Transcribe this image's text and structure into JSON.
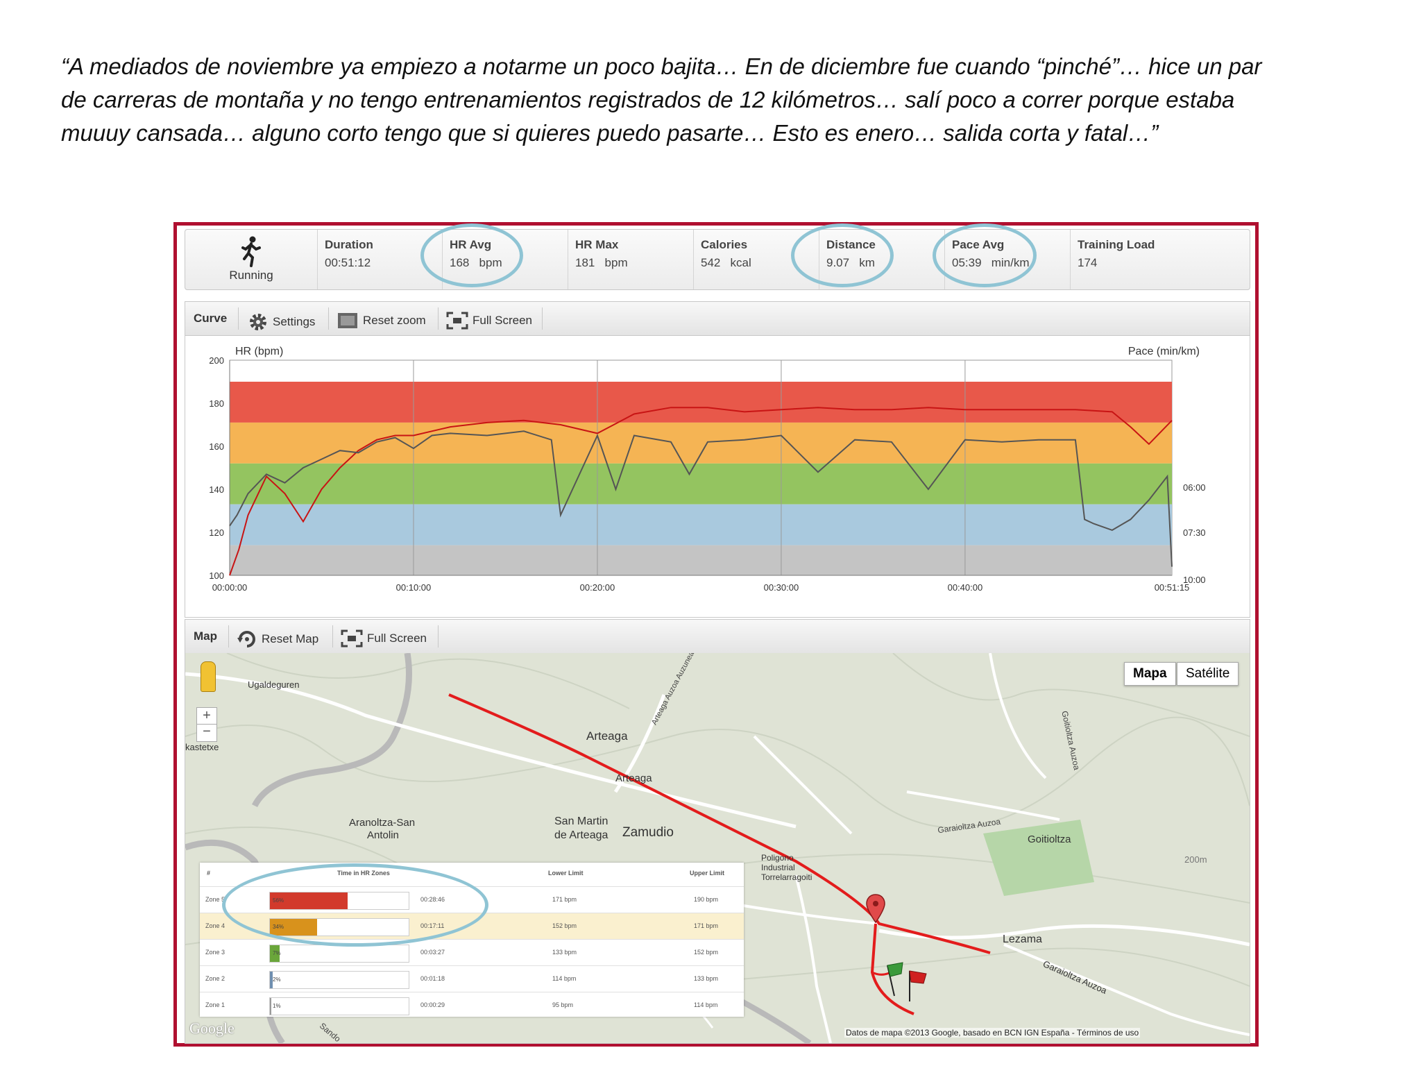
{
  "quote": {
    "line1": "“A mediados de noviembre ya empiezo a notarme un poco bajita… En de diciembre fue cuando “pinché”… hice un par",
    "line2": "de carreras de montaña y no tengo entrenamientos registrados de 12 kilómetros… salí poco a correr porque estaba",
    "line3": "muuuy cansada… alguno corto tengo que si quieres puedo pasarte… Esto es enero… salida corta y fatal…”"
  },
  "summary": {
    "activity": "Running",
    "activity_icon": "runner-icon",
    "stats": [
      {
        "label": "Duration",
        "value": "00:51:12"
      },
      {
        "label": "HR Avg",
        "value": "168   bpm"
      },
      {
        "label": "HR Max",
        "value": "181   bpm"
      },
      {
        "label": "Calories",
        "value": "542   kcal"
      },
      {
        "label": "Distance",
        "value": "9.07   km"
      },
      {
        "label": "Pace Avg",
        "value": "05:39   min/km"
      },
      {
        "label": "Training Load",
        "value": "174"
      }
    ]
  },
  "curve_toolbar": {
    "title": "Curve",
    "settings": "Settings",
    "reset_zoom": "Reset zoom",
    "full_screen": "Full Screen"
  },
  "chart_data": {
    "type": "line",
    "ylabel_left": "HR (bpm)",
    "ylabel_right": "Pace (min/km)",
    "ylim": [
      100,
      200
    ],
    "yticks": [
      "200",
      "180",
      "160",
      "140",
      "120",
      "100"
    ],
    "right_ticks": [
      "06:00",
      "07:30",
      "10:00"
    ],
    "xticks": [
      "00:00:00",
      "00:10:00",
      "00:20:00",
      "00:30:00",
      "00:40:00",
      "00:51:15"
    ],
    "zones": [
      {
        "from": 171,
        "to": 190,
        "color": "#e8584a"
      },
      {
        "from": 152,
        "to": 171,
        "color": "#f5b454"
      },
      {
        "from": 133,
        "to": 152,
        "color": "#94c460"
      },
      {
        "from": 114,
        "to": 133,
        "color": "#a9c9de"
      },
      {
        "from": 100,
        "to": 114,
        "color": "#c4c4c4"
      }
    ],
    "series": [
      {
        "color": "#c81414",
        "x": [
          0,
          0.5,
          1,
          2,
          3,
          4,
          5,
          6,
          7,
          8,
          9,
          10,
          12,
          14,
          16,
          18,
          20,
          22,
          24,
          26,
          28,
          30,
          32,
          34,
          36,
          38,
          40,
          42,
          44,
          46,
          48,
          49,
          50,
          51.25
        ],
        "y": [
          100,
          112,
          128,
          146,
          138,
          125,
          140,
          150,
          158,
          163,
          165,
          165,
          169,
          171,
          172,
          170,
          166,
          175,
          178,
          178,
          176,
          177,
          178,
          177,
          177,
          178,
          177,
          177,
          177,
          177,
          176,
          169,
          161,
          172
        ]
      },
      {
        "color": "#555555",
        "x": [
          0,
          0.4,
          1,
          2,
          3,
          4,
          5,
          6,
          7,
          8,
          9,
          10,
          11,
          12,
          14,
          16,
          17.5,
          18,
          20,
          21,
          22,
          24,
          25,
          26,
          28,
          30,
          32,
          34,
          36,
          38,
          40,
          42,
          44,
          46,
          46.5,
          47,
          48,
          49,
          50,
          51,
          51.25
        ],
        "y": [
          123,
          128,
          138,
          147,
          143,
          150,
          154,
          158,
          157,
          162,
          164,
          159,
          165,
          166,
          165,
          167,
          163,
          128,
          165,
          140,
          165,
          162,
          147,
          162,
          163,
          165,
          148,
          163,
          162,
          140,
          163,
          162,
          163,
          163,
          126,
          124,
          121,
          126,
          135,
          146,
          104
        ]
      }
    ]
  },
  "map_toolbar": {
    "title": "Map",
    "reset_map": "Reset Map",
    "full_screen": "Full Screen"
  },
  "map": {
    "type_buttons": [
      "Mapa",
      "Satélite"
    ],
    "labels": {
      "ugaldeguren": "Ugaldeguren",
      "kastetxe": "kastetxe",
      "arteaga1": "Arteaga",
      "arteaga2": "Arteaga",
      "arteaga_auzoa": "Arteaga Auzoa Auzunea",
      "goitioltza_auzoa": "Goitioltza Auzoa",
      "garaioltza_auzoa": "Garaioltza Auzoa",
      "goitioltza": "Goitioltza",
      "aranoltza1": "Aranoltza-San",
      "aranoltza2": "Antolin",
      "san_martin1": "San Martin",
      "san_martin2": "de Arteaga",
      "zamudio": "Zamudio",
      "poligono1": "Poligono",
      "poligono2": "Industrial",
      "poligono3": "Torrelarragoiti",
      "lezama": "Lezama",
      "garaioltza2": "Garaioltza Auzoa",
      "contour": "200m",
      "sando": "Sando",
      "google": "Google",
      "attribution": "Datos de mapa ©2013 Google, basado en BCN IGN España - Términos de uso"
    }
  },
  "zones_table": {
    "headers": [
      "#",
      "Time in HR Zones",
      "Lower Limit",
      "Upper Limit"
    ],
    "rows": [
      {
        "zone": "Zone 5",
        "pct_label": "56%",
        "fraction": 0.56,
        "time": "00:28:46",
        "lower": "171 bpm",
        "upper": "190 bpm",
        "color": "#d23a2c"
      },
      {
        "zone": "Zone 4",
        "pct_label": "34%",
        "fraction": 0.34,
        "time": "00:17:11",
        "lower": "152 bpm",
        "upper": "171 bpm",
        "color": "#d8921c"
      },
      {
        "zone": "Zone 3",
        "pct_label": "7%",
        "fraction": 0.07,
        "time": "00:03:27",
        "lower": "133 bpm",
        "upper": "152 bpm",
        "color": "#6aa63a"
      },
      {
        "zone": "Zone 2",
        "pct_label": "2%",
        "fraction": 0.02,
        "time": "00:01:18",
        "lower": "114 bpm",
        "upper": "133 bpm",
        "color": "#6f8fb0"
      },
      {
        "zone": "Zone 1",
        "pct_label": "1%",
        "fraction": 0.01,
        "time": "00:00:29",
        "lower": "95 bpm",
        "upper": "114 bpm",
        "color": "#9a9a9a"
      }
    ]
  }
}
